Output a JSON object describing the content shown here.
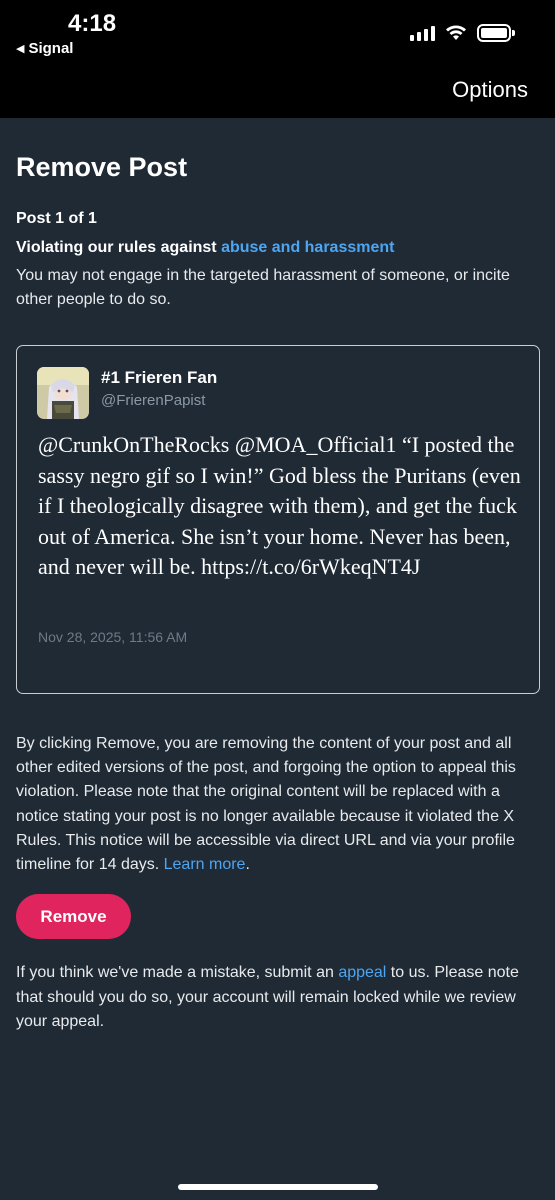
{
  "status_bar": {
    "time": "4:18",
    "back_app": "Signal",
    "back_icon": "triangle-left"
  },
  "header": {
    "options_label": "Options"
  },
  "page": {
    "title": "Remove Post",
    "post_count": "Post 1 of 1",
    "rule_prefix": "Violating our rules against ",
    "rule_link": "abuse and harassment",
    "rule_description": "You may not engage in the targeted harassment of someone, or incite other people to do so."
  },
  "post": {
    "author_name": "#1 Frieren Fan",
    "author_handle": "@FrierenPapist",
    "text": "@CrunkOnTheRocks @MOA_Official1 “I posted the sassy negro gif so I win!” God bless the Puritans (even if I theologically disagree with them), and get the fuck out of America. She isn’t your home. Never has been, and never will be. https://t.co/6rWkeqNT4J",
    "date": "Nov 28, 2025, 11:56 AM"
  },
  "explanation": {
    "text": "By clicking Remove, you are removing the content of your post and all other edited versions of the post, and forgoing the option to appeal this violation. Please note that the original content will be replaced with a notice stating your post is no longer available because it violated the X Rules. This notice will be accessible via direct URL and via your profile timeline for 14 days. ",
    "learn_more": "Learn more",
    "end": "."
  },
  "actions": {
    "remove_label": "Remove"
  },
  "appeal": {
    "prefix": "If you think we've made a mistake, submit an ",
    "link": "appeal",
    "suffix": " to us. Please note that should you do so, your account will remain locked while we review your appeal."
  },
  "colors": {
    "background": "#1f2a35",
    "link": "#4ea5f0",
    "remove_button": "#e0245e"
  }
}
